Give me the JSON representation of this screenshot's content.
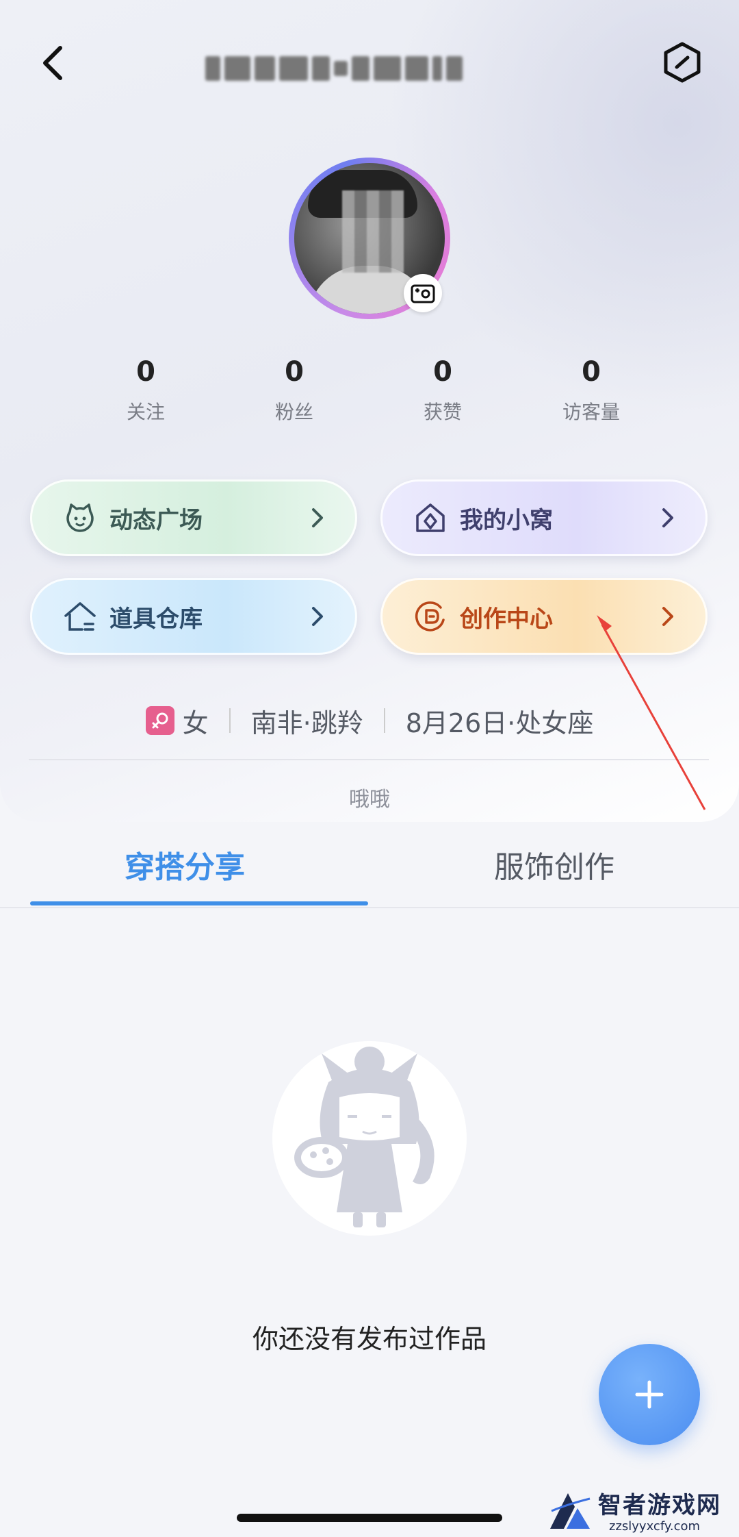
{
  "header": {
    "title": "",
    "back_icon": "chevron-left-icon",
    "settings_icon": "hexagon-settings-icon"
  },
  "avatar": {
    "camera_icon": "camera-icon"
  },
  "stats": [
    {
      "value": "0",
      "label": "关注"
    },
    {
      "value": "0",
      "label": "粉丝"
    },
    {
      "value": "0",
      "label": "获赞"
    },
    {
      "value": "0",
      "label": "访客量"
    }
  ],
  "menu": [
    {
      "label": "动态广场",
      "icon": "cat-face-icon",
      "color": "#3c5a55"
    },
    {
      "label": "我的小窝",
      "icon": "home-diamond-icon",
      "color": "#3f3f6d"
    },
    {
      "label": "道具仓库",
      "icon": "warehouse-icon",
      "color": "#2c4c6b"
    },
    {
      "label": "创作中心",
      "icon": "create-center-icon",
      "color": "#b94718"
    }
  ],
  "profile_info": {
    "gender": "女",
    "region": "南非·跳羚",
    "birthday": "8月26日·处女座"
  },
  "bio": "哦哦",
  "tabs": [
    {
      "label": "穿搭分享",
      "active": true
    },
    {
      "label": "服饰创作",
      "active": false
    }
  ],
  "empty_state": {
    "text": "你还没有发布过作品"
  },
  "fab": {
    "icon": "plus-icon"
  },
  "watermark": {
    "main": "智者游戏网",
    "sub": "zzslyyxcfy.com"
  },
  "colors": {
    "accent": "#3f8fe8",
    "fab": "#4b8df0",
    "annotation_arrow": "#e8413a"
  }
}
